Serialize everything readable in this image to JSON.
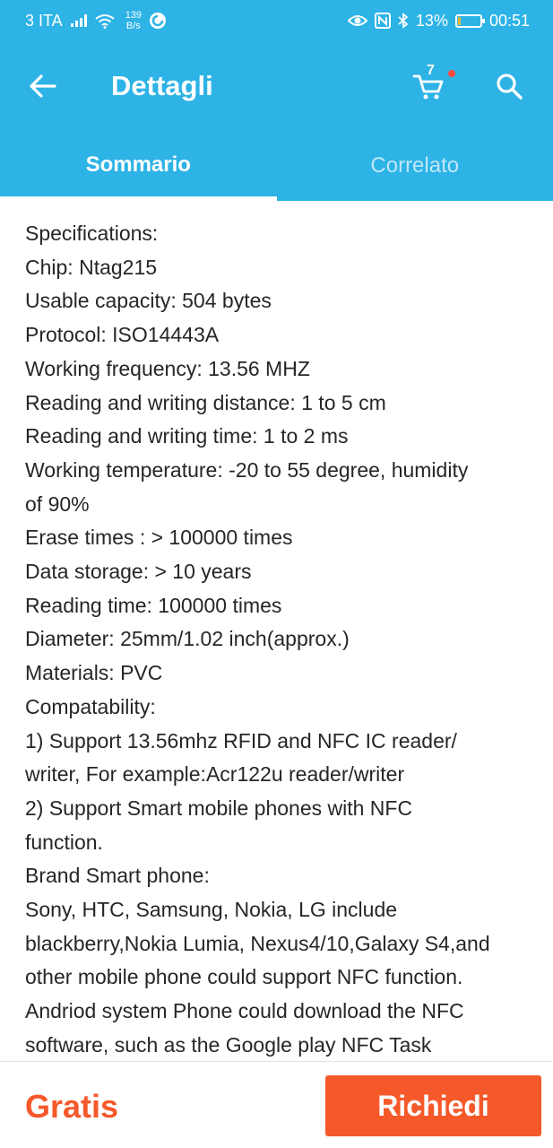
{
  "status_bar": {
    "carrier": "3 ITA",
    "net_speed_value": "139",
    "net_speed_unit": "B/s",
    "battery_percent": "13%",
    "time": "00:51",
    "battery_level": 0.13,
    "battery_fill_color": "#f5b52e"
  },
  "app_bar": {
    "title": "Dettagli",
    "cart_count": "7"
  },
  "tabs": [
    {
      "label": "Sommario",
      "active": true
    },
    {
      "label": "Correlato",
      "active": false
    }
  ],
  "content": {
    "lines": [
      "Specifications:",
      "Chip: Ntag215",
      "Usable capacity: 504 bytes",
      "Protocol: ISO14443A",
      "Working frequency: 13.56 MHZ",
      "Reading and writing distance: 1 to 5 cm",
      "Reading and writing time: 1 to 2 ms",
      "Working temperature: -20 to 55 degree, humidity",
      "of 90%",
      "Erase times : > 100000 times",
      "Data storage: > 10 years",
      "Reading time: 100000 times",
      "Diameter: 25mm/1.02 inch(approx.)",
      "Materials: PVC",
      "Compatability:",
      "1) Support 13.56mhz RFID and NFC IC reader/",
      "writer, For example:Acr122u reader/writer",
      "2) Support Smart mobile phones with NFC",
      "function.",
      "Brand Smart phone:",
      "Sony, HTC, Samsung, Nokia, LG include",
      "blackberry,Nokia Lumia, Nexus4/10,Galaxy S4,and",
      "other mobile phone could support NFC function.",
      "Andriod system Phone could download the NFC",
      "software, such as the Google play NFC Task"
    ]
  },
  "bottom_bar": {
    "price_label": "Gratis",
    "request_button": "Richiedi"
  },
  "colors": {
    "header": "#2db3e6",
    "accent": "#f5592a",
    "text": "#262626",
    "cart_badge_dot": "#ff4a3d"
  }
}
